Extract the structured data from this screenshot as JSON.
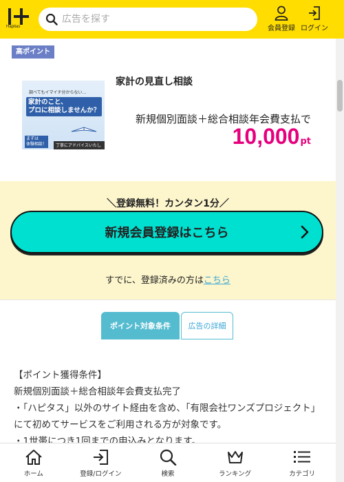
{
  "header": {
    "logo_text": "Hapitas",
    "search_placeholder": "広告を探す",
    "register_label": "会員登録",
    "login_label": "ログイン",
    "bg_color": "#ffdd00"
  },
  "offer": {
    "badge": "高ポイント",
    "title": "家計の見直し相談",
    "condition": "新規個別面談＋総合相談年会費支払で",
    "points": "10,000",
    "points_unit": "pt",
    "points_color": "#e6007e",
    "image": {
      "line1": "調べてもイマイチ分からない…",
      "line2": "家計のこと、",
      "line3": "プロに相談しませんか？",
      "line4": "まずは",
      "line5": "体験相談！",
      "line6": "丁寧にアドバイスいたします"
    }
  },
  "register": {
    "headline": "＼登録無料！カンタン1分／",
    "button_label": "新規会員登録はこちら",
    "login_prefix": "すでに、登録済みの方は",
    "login_link": "こちら",
    "button_color": "#00e0d0"
  },
  "tabs": [
    {
      "label": "ポイント対象条件",
      "active": true
    },
    {
      "label": "広告の詳細",
      "active": false
    }
  ],
  "conditions": {
    "lines": [
      "【ポイント獲得条件】",
      "新規個別面談＋総合相談年会費支払完了",
      "・「ハピタス」以外のサイト経由を含め、「有限会社ワンズプロジェクト」にて初めてサービスをご利用される方が対象です。",
      "・1世帯につき1回までの申込みとなります。"
    ]
  },
  "bottom_nav": [
    {
      "label": "ホーム",
      "icon": "home-icon"
    },
    {
      "label": "登録/ログイン",
      "icon": "login-icon"
    },
    {
      "label": "検索",
      "icon": "search-icon"
    },
    {
      "label": "ランキング",
      "icon": "crown-icon"
    },
    {
      "label": "カテゴリ",
      "icon": "list-icon"
    }
  ]
}
